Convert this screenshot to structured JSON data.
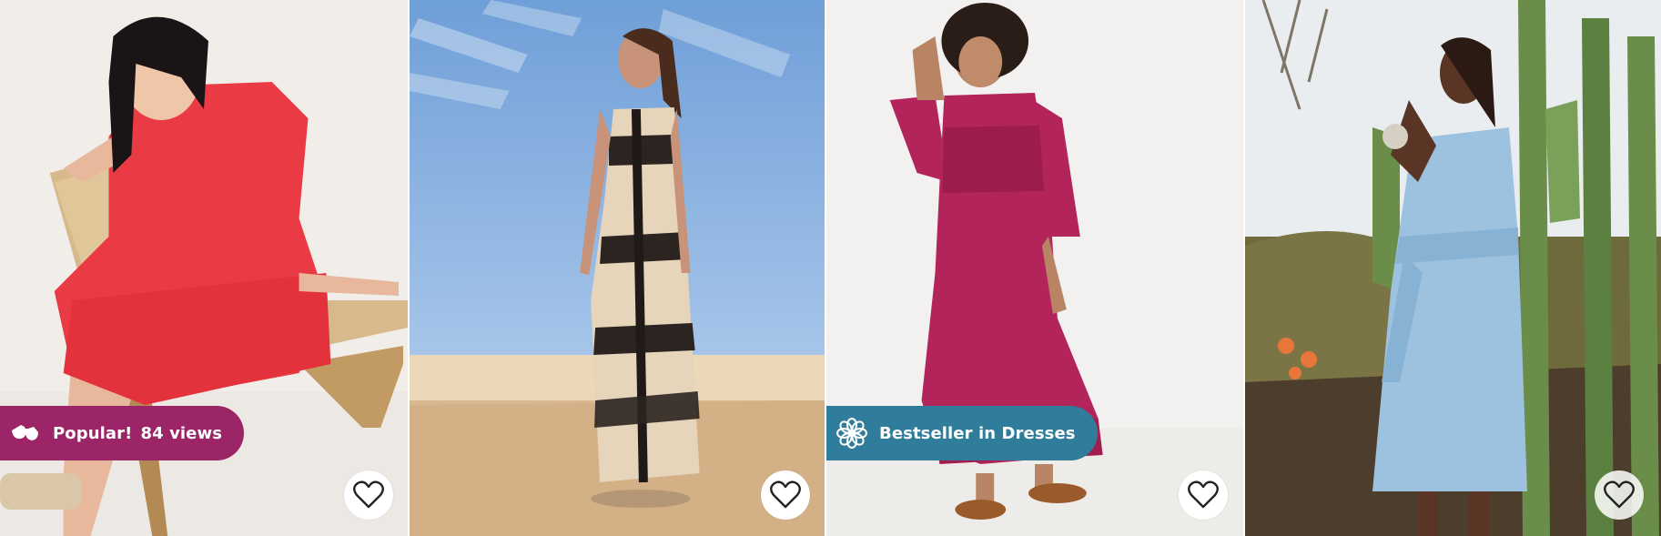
{
  "products": [
    {
      "name": "red-eyelet-dress",
      "badge": {
        "icon": "sunglasses-icon",
        "label": "Popular!",
        "count": "84 views",
        "color": "#9b2566"
      }
    },
    {
      "name": "printed-maxi-dress"
    },
    {
      "name": "magenta-smocked-dress",
      "badge": {
        "icon": "flower-icon",
        "label": "Bestseller in Dresses",
        "color": "#2f7d9a"
      }
    },
    {
      "name": "chambray-wrap-dress"
    }
  ],
  "favorite_icon": "heart-outline-icon",
  "colors": {
    "popular_badge": "#9b2566",
    "bestseller_badge": "#2f7d9a"
  }
}
